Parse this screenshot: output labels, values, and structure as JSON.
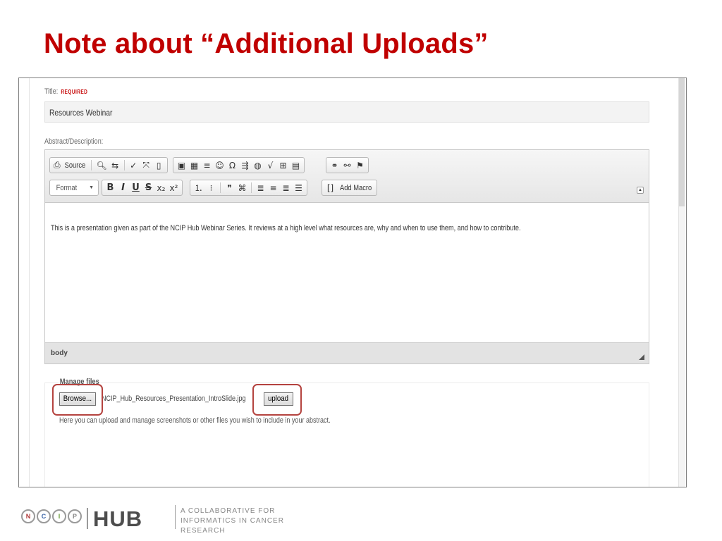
{
  "slide": {
    "title": "Note about “Additional Uploads”"
  },
  "form": {
    "title_label": "Title:",
    "required_label": "REQUIRED",
    "title_value": "Resources Webinar",
    "abstract_label": "Abstract/Description:"
  },
  "editor": {
    "toolbar_row1": [
      {
        "name": "source-button",
        "icon": "source-icon",
        "glyph": "⎙",
        "label": "Source"
      },
      {
        "name": "find-button",
        "icon": "search-icon",
        "glyph": "🔍︎",
        "label": ""
      },
      {
        "name": "replace-button",
        "icon": "replace-icon",
        "glyph": "⇆",
        "label": ""
      },
      {
        "name": "spellcheck-button",
        "icon": "spellcheck-icon",
        "glyph": "✓",
        "label": ""
      },
      {
        "name": "maximize-button",
        "icon": "maximize-icon",
        "glyph": "⤧",
        "label": ""
      },
      {
        "name": "show-blocks-button",
        "icon": "show-blocks-icon",
        "glyph": "▯",
        "label": ""
      },
      {
        "name": "image-button",
        "icon": "image-icon",
        "glyph": "▣",
        "label": ""
      },
      {
        "name": "table-button",
        "icon": "table-icon",
        "glyph": "▦",
        "label": ""
      },
      {
        "name": "horizontal-rule-button",
        "icon": "horizontal-rule-icon",
        "glyph": "≡",
        "label": ""
      },
      {
        "name": "smiley-button",
        "icon": "smiley-icon",
        "glyph": "☺",
        "label": ""
      },
      {
        "name": "special-char-button",
        "icon": "omega-icon",
        "glyph": "Ω",
        "label": ""
      },
      {
        "name": "blockquote-list-button",
        "icon": "list-indent-icon",
        "glyph": "⇶",
        "label": ""
      },
      {
        "name": "globe-button",
        "icon": "globe-icon",
        "glyph": "◍",
        "label": ""
      },
      {
        "name": "math-button",
        "icon": "sqrt-icon",
        "glyph": "√",
        "label": ""
      },
      {
        "name": "grid-button",
        "icon": "grid-icon",
        "glyph": "⊞",
        "label": ""
      },
      {
        "name": "page-button",
        "icon": "page-icon",
        "glyph": "▤",
        "label": ""
      },
      {
        "name": "link-button",
        "icon": "link-icon",
        "glyph": "⚭",
        "label": ""
      },
      {
        "name": "unlink-button",
        "icon": "unlink-icon",
        "glyph": "⚯",
        "label": ""
      },
      {
        "name": "anchor-button",
        "icon": "flag-icon",
        "glyph": "⚑",
        "label": ""
      }
    ],
    "format_label": "Format",
    "toolbar_row2": [
      {
        "name": "bold-button",
        "icon": "bold-icon",
        "glyph": "B",
        "label": ""
      },
      {
        "name": "italic-button",
        "icon": "italic-icon",
        "glyph": "I",
        "label": ""
      },
      {
        "name": "underline-button",
        "icon": "underline-icon",
        "glyph": "U",
        "label": ""
      },
      {
        "name": "strikethrough-button",
        "icon": "strikethrough-icon",
        "glyph": "S",
        "label": ""
      },
      {
        "name": "subscript-button",
        "icon": "subscript-icon",
        "glyph": "x₂",
        "label": ""
      },
      {
        "name": "superscript-button",
        "icon": "superscript-icon",
        "glyph": "x²",
        "label": ""
      },
      {
        "name": "numbered-list-button",
        "icon": "numbered-list-icon",
        "glyph": "⒈",
        "label": ""
      },
      {
        "name": "bullet-list-button",
        "icon": "bullet-list-icon",
        "glyph": "⁝",
        "label": ""
      },
      {
        "name": "quote-button",
        "icon": "quote-icon",
        "glyph": "❞",
        "label": ""
      },
      {
        "name": "div-button",
        "icon": "div-icon",
        "glyph": "⌘",
        "label": ""
      },
      {
        "name": "align-left-button",
        "icon": "align-left-icon",
        "glyph": "≣",
        "label": ""
      },
      {
        "name": "align-center-button",
        "icon": "align-center-icon",
        "glyph": "≡",
        "label": ""
      },
      {
        "name": "align-right-button",
        "icon": "align-right-icon",
        "glyph": "≣",
        "label": ""
      },
      {
        "name": "justify-button",
        "icon": "justify-icon",
        "glyph": "☰",
        "label": ""
      }
    ],
    "add_macro_label": "Add Macro",
    "body_text": "This is a presentation given as part of the NCIP Hub Webinar Series. It reviews at a high level what resources are, why and when to use them, and how to contribute.",
    "status_label": "body"
  },
  "files": {
    "legend": "Manage files",
    "browse_label": "Browse...",
    "file_name": "NCIP_Hub_Resources_Presentation_IntroSlide.jpg",
    "upload_label": "upload",
    "help_text": "Here you can upload and manage screenshots or other files you wish to include in your abstract."
  },
  "highlight_color": "#b4433f",
  "title_color": "#c00000",
  "footer": {
    "ncip_letters": [
      "N",
      "C",
      "I",
      "P"
    ],
    "hub": "HUB",
    "tagline_lines": [
      "A COLLABORATIVE FOR",
      "INFORMATICS IN CANCER",
      "RESEARCH"
    ]
  }
}
